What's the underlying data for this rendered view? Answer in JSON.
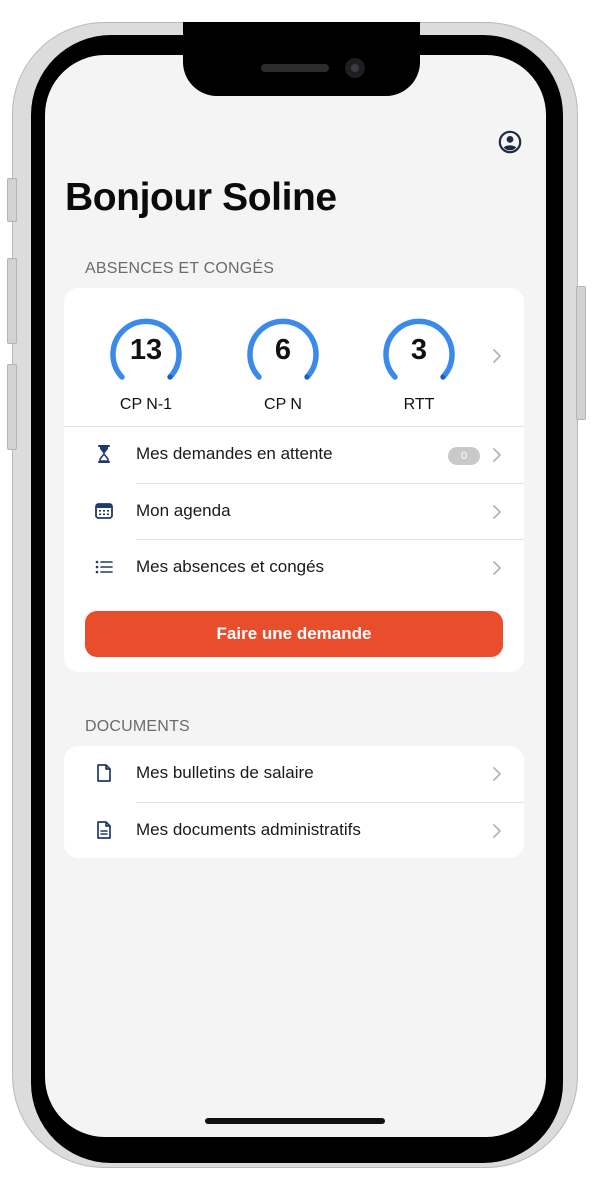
{
  "header": {
    "greeting": "Bonjour Soline",
    "profile_icon": "user-circle-icon"
  },
  "absences": {
    "section_title": "ABSENCES ET CONGÉS",
    "balances": [
      {
        "value": "13",
        "label": "CP N-1"
      },
      {
        "value": "6",
        "label": "CP N"
      },
      {
        "value": "3",
        "label": "RTT"
      }
    ],
    "menu": [
      {
        "icon": "hourglass-icon",
        "label": "Mes demandes en attente",
        "badge": "0"
      },
      {
        "icon": "calendar-icon",
        "label": "Mon agenda"
      },
      {
        "icon": "list-icon",
        "label": "Mes absences et congés"
      }
    ],
    "cta_label": "Faire une demande"
  },
  "documents": {
    "section_title": "DOCUMENTS",
    "menu": [
      {
        "icon": "document-icon",
        "label": "Mes bulletins de salaire"
      },
      {
        "icon": "document-text-icon",
        "label": "Mes documents administratifs"
      }
    ]
  },
  "colors": {
    "accent": "#e94d2c",
    "gauge": "#3b8aea",
    "background": "#f4f4f4",
    "card": "#ffffff"
  }
}
